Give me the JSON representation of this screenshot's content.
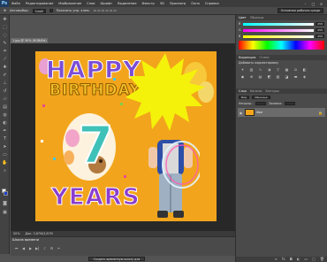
{
  "app": {
    "logo": "Ps"
  },
  "menu": [
    "Файл",
    "Редактирование",
    "Изображение",
    "Слои",
    "Шрифт",
    "Выделение",
    "Фильтр",
    "3D",
    "Просмотр",
    "Окно",
    "Справка"
  ],
  "window_controls": {
    "minimize": "–",
    "maximize": "□",
    "close": "✕"
  },
  "options_bar": {
    "tool_label": "Автовыбор:",
    "tool_value": "Слой",
    "show_controls_label": "Показать упр. элем.",
    "workspace": "Основная рабочая среда"
  },
  "document": {
    "tab_title": "1.jpg @ 50% (RGB/8#)",
    "close": "×",
    "zoom": "50%",
    "doc_info": "Док: 3,87M/3,87M"
  },
  "canvas_text": {
    "happy": "HAPPY",
    "birthday": "BIRTHDAY",
    "seven": "7",
    "years": "YEARS"
  },
  "timeline": {
    "title": "Шкала времени",
    "create_button": "Создать временную шкалу для видео"
  },
  "color_panel": {
    "tabs": [
      "Цвет",
      "Образцы"
    ],
    "channels": [
      {
        "label": "R",
        "value": "255"
      },
      {
        "label": "G",
        "value": "255"
      },
      {
        "label": "B",
        "value": "255"
      }
    ]
  },
  "adjustments_panel": {
    "tabs": [
      "Коррекция",
      "Стили"
    ],
    "subtitle": "Добавить корректировку"
  },
  "layers_panel": {
    "tabs": [
      "Слои",
      "Каналы",
      "Контуры"
    ],
    "kind_filter": "Вид",
    "blend_mode": "Обычные",
    "opacity_label": "Непрозр.:",
    "fill_label": "Заливка:",
    "layers": [
      {
        "name": "Фон",
        "visible": true,
        "locked": true,
        "selected": true
      }
    ]
  },
  "colors": {
    "foreground": "#ffffff",
    "background": "#1a3dd0",
    "canvas_bg": "#f2a51c"
  }
}
